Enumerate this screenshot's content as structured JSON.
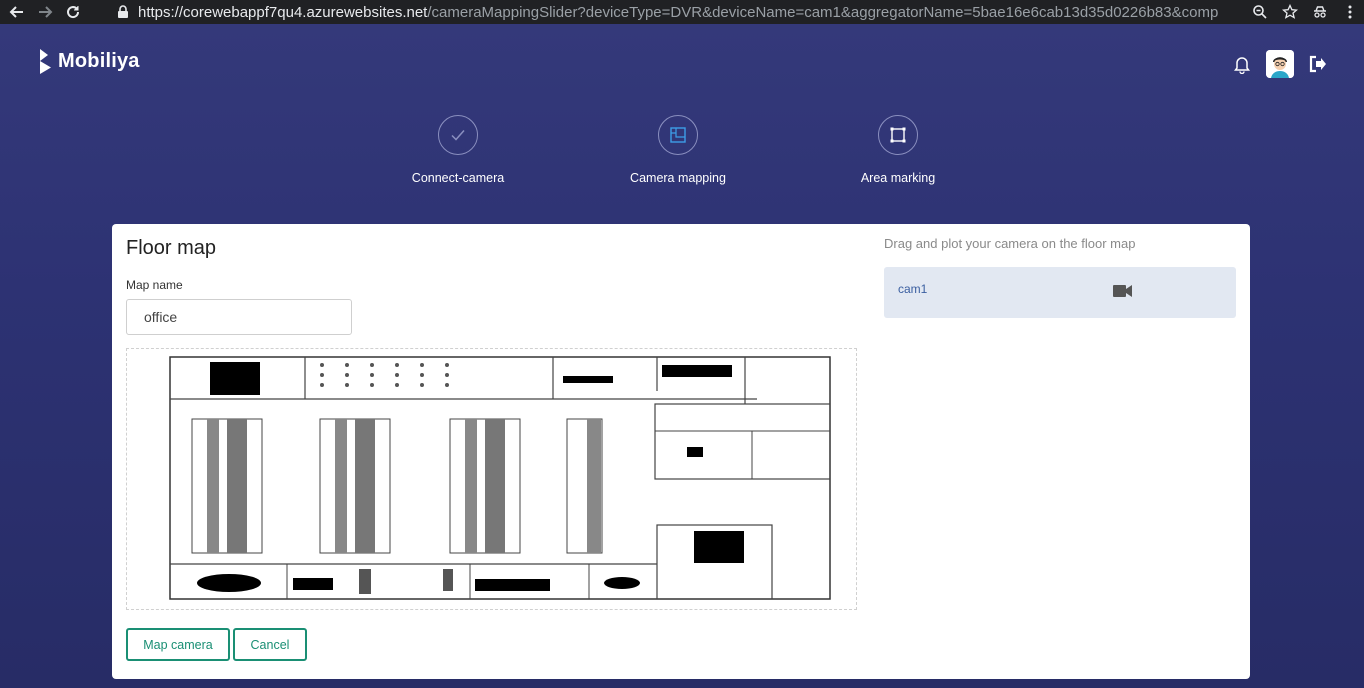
{
  "browser": {
    "url_host": "https://corewebappf7qu4.azurewebsites.net",
    "url_path": "/cameraMappingSlider?deviceType=DVR&deviceName=cam1&aggregatorName=5bae16e6cab13d35d0226b83&computeEngin..."
  },
  "header": {
    "brand": "Mobiliya"
  },
  "steps": [
    {
      "label": "Connect-camera",
      "icon": "check-icon"
    },
    {
      "label": "Camera mapping",
      "icon": "floor-plan-icon"
    },
    {
      "label": "Area marking",
      "icon": "area-select-icon"
    }
  ],
  "floor_map": {
    "title": "Floor map",
    "map_name_label": "Map name",
    "map_name_value": "office",
    "map_camera_button": "Map camera",
    "cancel_button": "Cancel"
  },
  "camera_panel": {
    "hint": "Drag and plot your camera on the floor map",
    "cameras": [
      {
        "name": "cam1",
        "icon": "video-camera-icon"
      }
    ]
  },
  "colors": {
    "accent": "#1a8f74",
    "background": "#2b3170",
    "camera_item_bg": "#e2e8f2",
    "active_step_icon": "#3d9ee8"
  }
}
